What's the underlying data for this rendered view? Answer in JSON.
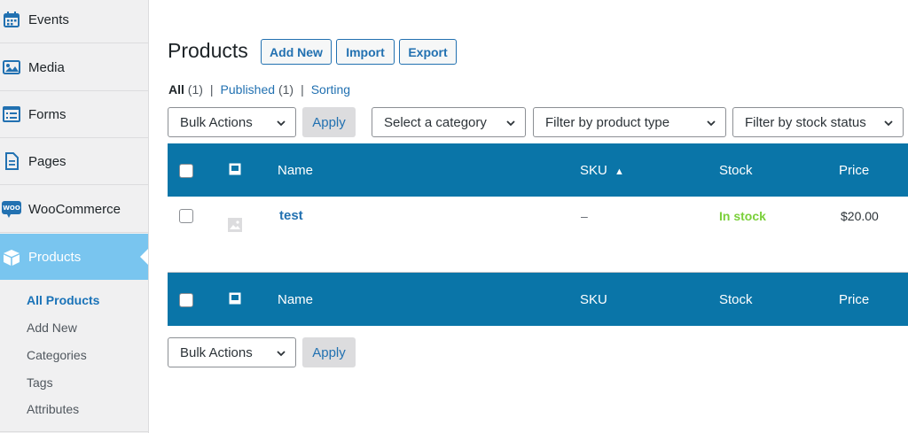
{
  "sidebar": {
    "menu": [
      {
        "label": "Events",
        "icon": "calendar-icon"
      },
      {
        "label": "Media",
        "icon": "media-icon"
      },
      {
        "label": "Forms",
        "icon": "forms-icon"
      },
      {
        "label": "Pages",
        "icon": "page-icon"
      },
      {
        "label": "WooCommerce",
        "icon": "woocommerce-icon",
        "icon_text": "WOO"
      },
      {
        "label": "Products",
        "icon": "box-icon",
        "active": true
      }
    ],
    "submenu": [
      {
        "label": "All Products",
        "current": true
      },
      {
        "label": "Add New"
      },
      {
        "label": "Categories"
      },
      {
        "label": "Tags"
      },
      {
        "label": "Attributes"
      }
    ]
  },
  "header": {
    "title": "Products",
    "buttons": {
      "add_new": "Add New",
      "import": "Import",
      "export": "Export"
    }
  },
  "views": {
    "all": {
      "label": "All",
      "count": "(1)"
    },
    "published": {
      "label": "Published",
      "count": "(1)"
    },
    "sorting": "Sorting",
    "separator": "|"
  },
  "filters": {
    "bulk_actions": "Bulk Actions",
    "apply": "Apply",
    "category": "Select a category",
    "product_type": "Filter by product type",
    "stock_status": "Filter by stock status"
  },
  "table": {
    "columns": {
      "name": "Name",
      "sku": "SKU",
      "stock": "Stock",
      "price": "Price"
    },
    "sort_indicator": "▲",
    "rows": [
      {
        "name": "test",
        "sku": "–",
        "stock": "In stock",
        "price": "$20.00"
      }
    ]
  },
  "colors": {
    "accent": "#2271b1",
    "table_header": "#0a75a8",
    "active_menu": "#79c5ef",
    "in_stock": "#7ad03a"
  }
}
